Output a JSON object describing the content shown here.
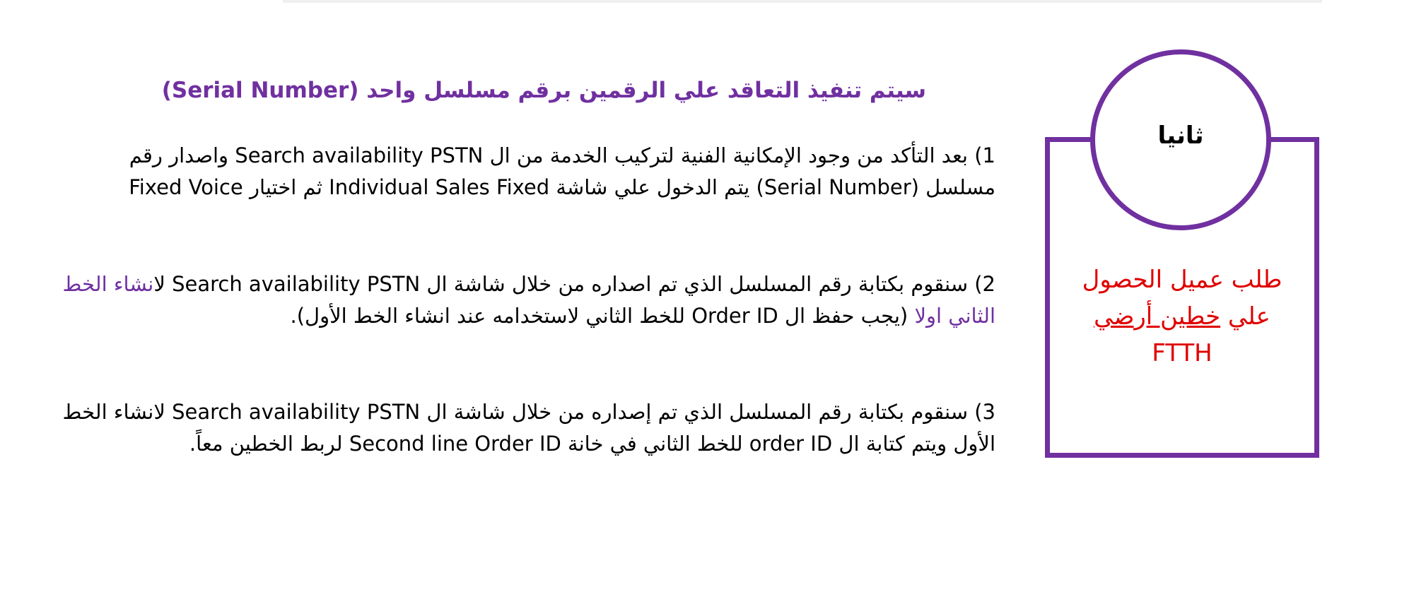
{
  "heading": "سيتم تنفيذ التعاقد علي الرقمين برقم مسلسل واحد (Serial Number)",
  "side": {
    "circle_label": "ثانيا",
    "request_line1": "طلب عميل الحصول",
    "request_line2_a": "علي ",
    "request_line2_b": "خطين أرضي",
    "request_line3": "FTTH",
    "frame_color": "#7030a0",
    "text_color": "#e00000"
  },
  "steps": [
    {
      "text": "1) بعد التأكد من وجود الإمكانية الفنية لتركيب الخدمة من ال  Search availability PSTN واصدار رقم مسلسل (Serial Number) يتم الدخول علي شاشة Individual Sales Fixed ثم اختيار Fixed Voice"
    },
    {
      "text_before": "2) سنقوم بكتابة رقم المسلسل الذي تم اصداره من خلال شاشة ال  Search availability PSTN ل",
      "highlight": "انشاء الخط الثاني اولا",
      "text_after": "  (يجب حفظ ال Order ID للخط الثاني لاستخدامه عند انشاء الخط الأول)."
    },
    {
      "text": "3) سنقوم بكتابة رقم المسلسل الذي تم إصداره من خلال شاشة ال  Search availability PSTN لانشاء الخط الأول ويتم كتابة ال order ID للخط الثاني في خانة Second line Order ID لربط الخطين معاً."
    }
  ],
  "colors": {
    "accent": "#7030a0",
    "alert": "#e00000",
    "body_text": "#000000"
  }
}
